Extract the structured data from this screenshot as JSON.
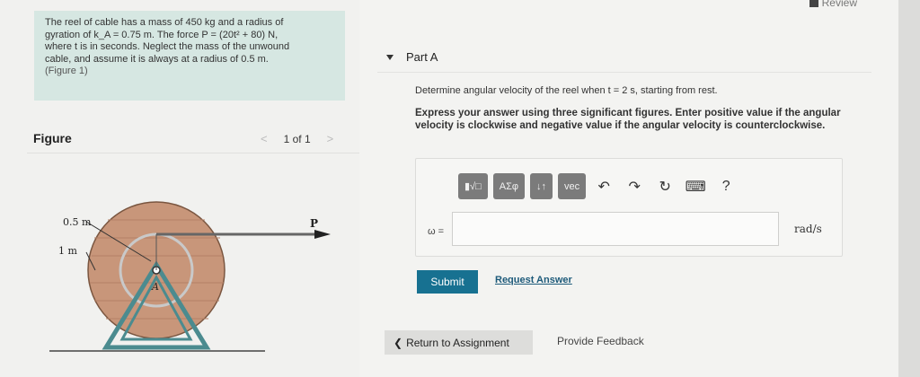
{
  "header": {
    "review_label": "Review"
  },
  "problem": {
    "line1": "The reel of cable has a mass of 450 kg and a radius of",
    "line2": "gyration of k_A = 0.75 m. The force P = (20t² + 80) N,",
    "line3": "where t is in seconds. Neglect the mass of the unwound",
    "line4": "cable, and assume it is always at a radius of 0.5 m.",
    "figure_link": "(Figure 1)"
  },
  "figure": {
    "title": "Figure",
    "pager": "1 of 1",
    "prev_glyph": "<",
    "next_glyph": ">",
    "label_outer": "0.5 m",
    "label_inner": "1 m",
    "label_force": "P",
    "label_point": "A"
  },
  "part": {
    "title": "Part A",
    "question": "Determine angular velocity of the reel when t = 2 s, starting from rest.",
    "instructions": "Express your answer using three significant figures. Enter positive value if the angular velocity is clockwise and negative value if the angular velocity is counterclockwise."
  },
  "toolbar": {
    "templates_label": "▮√□",
    "greek_label": "ΑΣφ",
    "arrows_label": "↓↑",
    "vec_label": "vec",
    "undo_glyph": "↶",
    "redo_glyph": "↷",
    "reset_glyph": "↻",
    "keyboard_glyph": "⌨",
    "help_glyph": "?"
  },
  "answer": {
    "variable": "ω =",
    "value": "",
    "unit": "rad/s"
  },
  "actions": {
    "submit": "Submit",
    "request": "Request Answer",
    "return": "Return to Assignment",
    "return_glyph": "❮",
    "feedback": "Provide Feedback"
  }
}
